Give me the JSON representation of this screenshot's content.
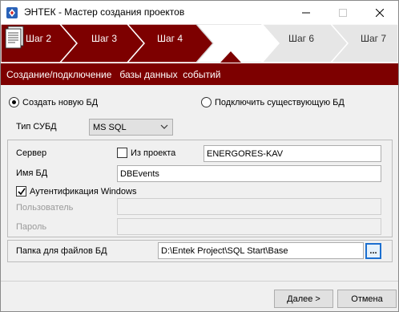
{
  "window": {
    "title": "ЭНТЕК - Мастер создания проектов",
    "accent_color": "#7d0000"
  },
  "steps": {
    "items": [
      {
        "label": "Шаг 2",
        "state": "done"
      },
      {
        "label": "Шаг 3",
        "state": "done"
      },
      {
        "label": "Шаг 4",
        "state": "done"
      },
      {
        "label": "",
        "state": "current",
        "icon": "document-icon"
      },
      {
        "label": "Шаг 6",
        "state": "pending"
      },
      {
        "label": "Шаг 7",
        "state": "pending"
      }
    ]
  },
  "header": {
    "text": "Создание/подключение   базы данных  событий"
  },
  "mode": {
    "create_label": "Создать новую БД",
    "create_selected": true,
    "connect_label": "Подключить существующую БД",
    "connect_selected": false
  },
  "dbms": {
    "label": "Тип СУБД",
    "value": "MS SQL"
  },
  "server": {
    "label": "Сервер",
    "from_project_label": "Из проекта",
    "from_project_checked": false,
    "value": "ENERGORES-KAV"
  },
  "dbname": {
    "label": "Имя БД",
    "value": "DBEvents"
  },
  "auth": {
    "label": "Аутентификация Windows",
    "checked": true
  },
  "user": {
    "label": "Пользователь",
    "value": ""
  },
  "password": {
    "label": "Пароль",
    "value": ""
  },
  "folder": {
    "label": "Папка для файлов БД",
    "value": "D:\\Entek Project\\SQL Start\\Base",
    "browse_label": "..."
  },
  "buttons": {
    "next": "Далее >",
    "cancel": "Отмена"
  }
}
